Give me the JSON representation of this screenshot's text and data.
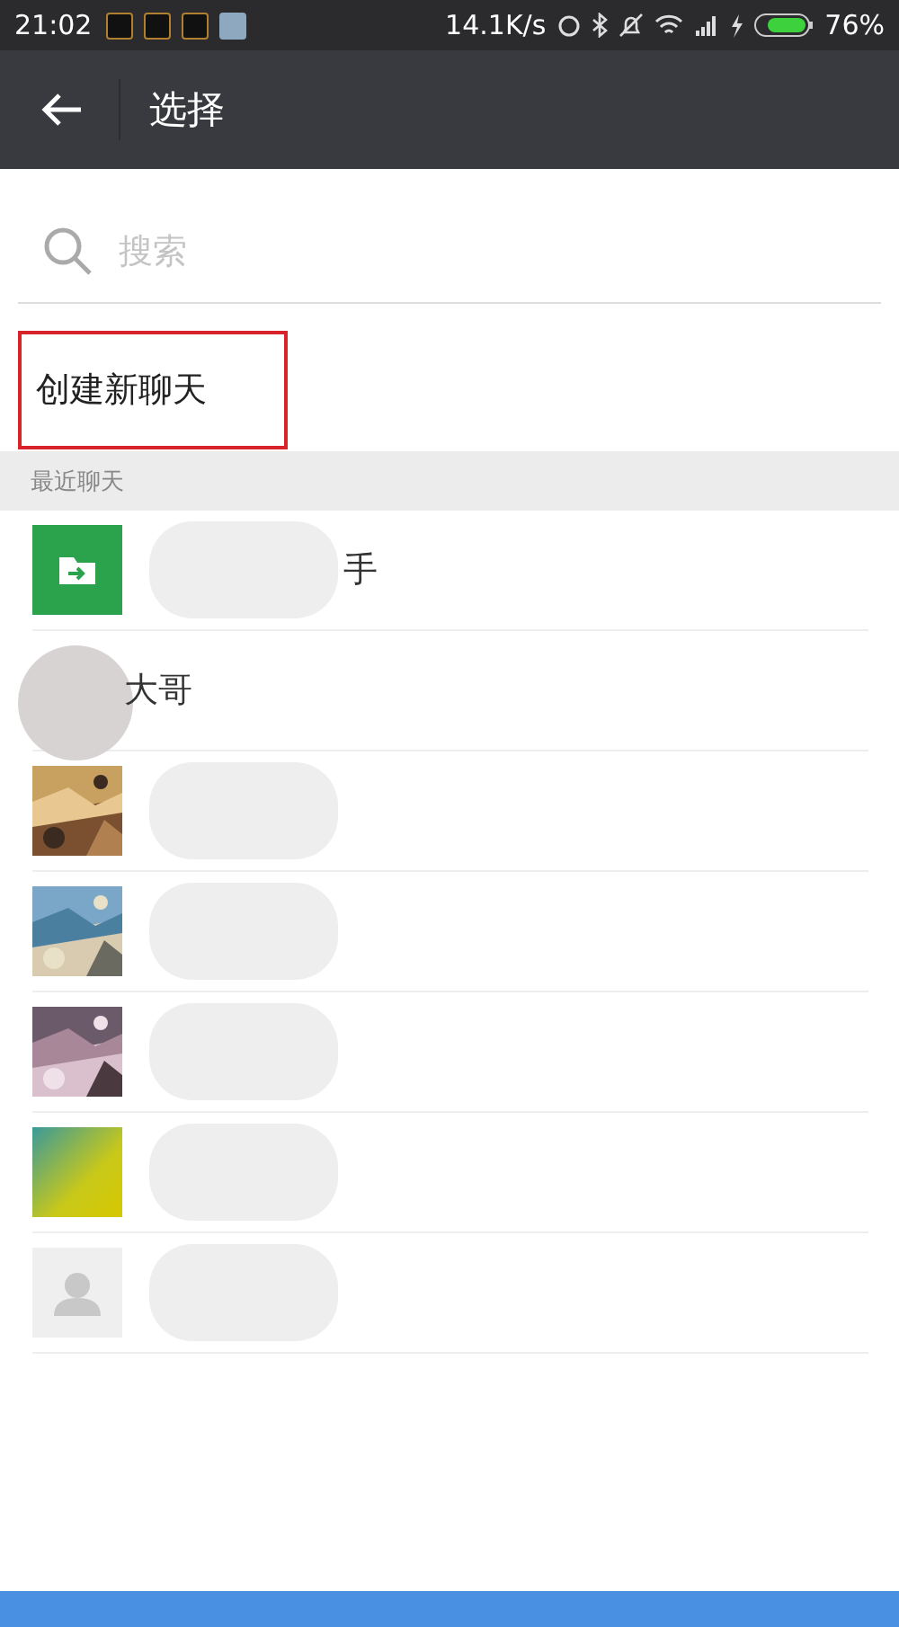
{
  "status_bar": {
    "time": "21:02",
    "speed": "14.1K/s",
    "battery": "76%"
  },
  "title_bar": {
    "title": "选择"
  },
  "search": {
    "placeholder": "搜索"
  },
  "create_chat": {
    "label": "创建新聊天",
    "highlighted": true
  },
  "section": {
    "title": "最近聊天"
  },
  "chats": [
    {
      "kind": "folder",
      "name": "手",
      "name_masked": true
    },
    {
      "kind": "masked",
      "name": "大哥",
      "name_masked": false
    },
    {
      "kind": "picture",
      "name_masked": true
    },
    {
      "kind": "picture",
      "name_masked": true
    },
    {
      "kind": "picture",
      "name_masked": true
    },
    {
      "kind": "gradient",
      "name_masked": true
    },
    {
      "kind": "person",
      "name_masked": true
    }
  ]
}
